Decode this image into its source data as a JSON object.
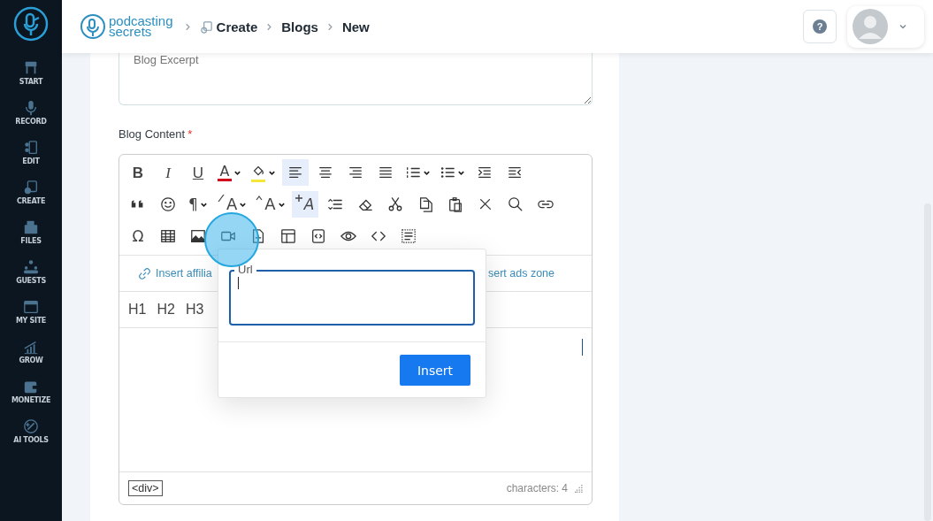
{
  "sidebar": {
    "items": [
      {
        "kind": "start",
        "label": "START"
      },
      {
        "kind": "record",
        "label": "RECORD"
      },
      {
        "kind": "edit",
        "label": "EDIT"
      },
      {
        "kind": "create",
        "label": "CREATE"
      },
      {
        "kind": "files",
        "label": "FILES"
      },
      {
        "kind": "guests",
        "label": "GUESTS"
      },
      {
        "kind": "site",
        "label": "MY SITE"
      },
      {
        "kind": "grow",
        "label": "GROW"
      },
      {
        "kind": "monetize",
        "label": "MONETIZE"
      },
      {
        "kind": "ai",
        "label": "AI TOOLS"
      }
    ]
  },
  "header": {
    "logo": {
      "line1": "podcasting",
      "line2": "secrets"
    },
    "breadcrumbs": [
      "Create",
      "Blogs",
      "New"
    ],
    "help_label": "?"
  },
  "form": {
    "excerpt": {
      "placeholder": "Blog Excerpt"
    },
    "content_label": "Blog Content",
    "required_mark": "*"
  },
  "editor": {
    "toolbar": [
      [
        {
          "kind": "bold",
          "label": "B",
          "active": false,
          "dropdown": false
        },
        {
          "kind": "italic",
          "label": "I",
          "active": false,
          "dropdown": false
        },
        {
          "kind": "underline",
          "label": "U",
          "active": false,
          "dropdown": false
        },
        {
          "kind": "font-color",
          "label": "A",
          "color": "#d0021b",
          "active": false,
          "dropdown": true
        },
        {
          "kind": "highlight",
          "color": "#f5e63b",
          "active": false,
          "dropdown": true
        },
        {
          "kind": "align-left",
          "active": true,
          "dropdown": false
        },
        {
          "kind": "align-center",
          "active": false,
          "dropdown": false
        },
        {
          "kind": "align-right",
          "active": false,
          "dropdown": false
        },
        {
          "kind": "justify",
          "active": false,
          "dropdown": false
        },
        {
          "kind": "ordered-list",
          "active": false,
          "dropdown": true
        },
        {
          "kind": "unordered-list",
          "active": false,
          "dropdown": true
        },
        {
          "kind": "indent",
          "active": false,
          "dropdown": false
        },
        {
          "kind": "outdent",
          "active": false,
          "dropdown": false
        }
      ],
      [
        {
          "kind": "quote",
          "active": false,
          "dropdown": false
        },
        {
          "kind": "emoji",
          "active": false,
          "dropdown": false
        },
        {
          "kind": "paragraph",
          "label": "¶",
          "active": false,
          "dropdown": true
        },
        {
          "kind": "font-size",
          "label": "A",
          "active": false,
          "dropdown": true
        },
        {
          "kind": "text-size",
          "label": "A",
          "active": false,
          "dropdown": true
        },
        {
          "kind": "class",
          "label": "A",
          "active": true,
          "dropdown": false
        },
        {
          "kind": "line-height",
          "active": false,
          "dropdown": false
        },
        {
          "kind": "eraser",
          "active": false,
          "dropdown": false
        },
        {
          "kind": "cut",
          "active": false,
          "dropdown": false
        },
        {
          "kind": "copy",
          "active": false,
          "dropdown": false
        },
        {
          "kind": "paste",
          "active": false,
          "dropdown": false
        },
        {
          "kind": "remove",
          "active": false,
          "dropdown": false
        },
        {
          "kind": "search",
          "active": false,
          "dropdown": false
        },
        {
          "kind": "link",
          "active": false,
          "dropdown": false
        }
      ],
      [
        {
          "kind": "symbol",
          "label": "Ω",
          "active": false,
          "dropdown": false
        },
        {
          "kind": "table",
          "active": false,
          "dropdown": false
        },
        {
          "kind": "image",
          "active": false,
          "dropdown": false
        },
        {
          "kind": "video",
          "active": false,
          "dropdown": false
        },
        {
          "kind": "file",
          "active": false,
          "dropdown": false
        },
        {
          "kind": "template",
          "active": false,
          "dropdown": false
        },
        {
          "kind": "source",
          "active": false,
          "dropdown": false
        },
        {
          "kind": "preview",
          "active": false,
          "dropdown": false
        },
        {
          "kind": "code",
          "active": false,
          "dropdown": false
        },
        {
          "kind": "select-all",
          "active": false,
          "dropdown": false
        }
      ]
    ],
    "links": [
      "Insert affilia",
      "sert ads zone"
    ],
    "headings": [
      "H1",
      "H2",
      "H3"
    ],
    "path": "<div>",
    "char_count": "characters: 4"
  },
  "popup": {
    "field_label": "Url",
    "focused": true,
    "button": "Insert"
  }
}
